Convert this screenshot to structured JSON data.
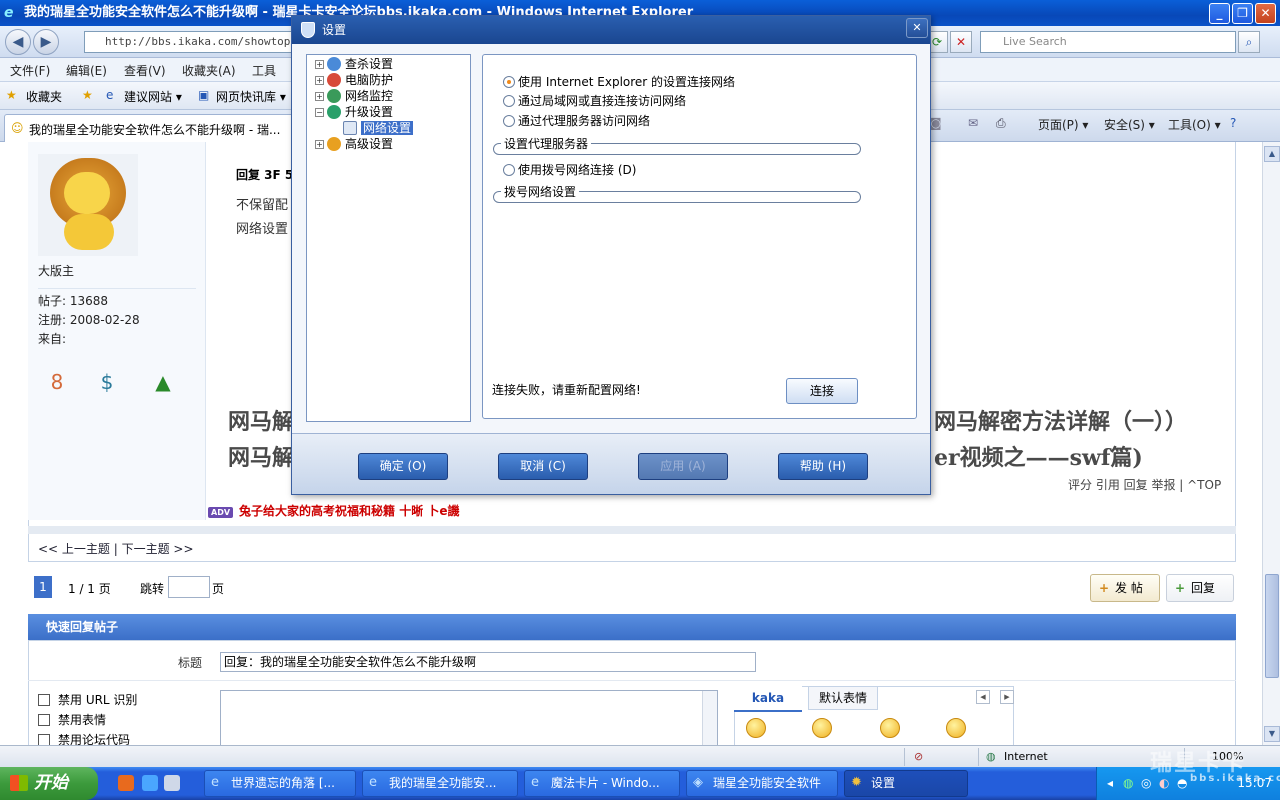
{
  "browser": {
    "title": "我的瑞星全功能安全软件怎么不能升级啊 - 瑞星卡卡安全论坛bbs.ikaka.com - Windows Internet Explorer",
    "url": "http://bbs.ikaka.com/showtopic",
    "search_placeholder": "Live Search",
    "menu": [
      "文件(F)",
      "编辑(E)",
      "查看(V)",
      "收藏夹(A)",
      "工具"
    ],
    "favorites": {
      "label": "收藏夹",
      "items": [
        "建议网站 ▾",
        "网页快讯库 ▾"
      ]
    },
    "tab_title": "我的瑞星全功能安全软件怎么不能升级啊 - 瑞...",
    "command_bar": [
      "页面(P) ▾",
      "安全(S) ▾",
      "工具(O) ▾"
    ]
  },
  "forum": {
    "user": {
      "name": "大版主",
      "posts": "帖子: 13688",
      "registered": "注册:  2008-02-28",
      "from": "来自:"
    },
    "post": {
      "header": "回复 3F 5",
      "line1": "不保留配",
      "line2": "网络设置"
    },
    "big_links": {
      "left1": "网马解",
      "left2": "网马解",
      "right1": "网马解密方法详解（一））",
      "right2": "er视频之——swf篇)"
    },
    "post_actions": "评分  引用  回复 举报 | ^TOP",
    "ad": {
      "badge": "ADV",
      "text": "兔子给大家的高考祝福和秘籍  十晰 卜e譏"
    },
    "prev_next": "<< 上一主题 | 下一主题 >>",
    "pager": {
      "current": "1",
      "total": "1  /  1  页",
      "jump": "跳转",
      "page": "页"
    },
    "new_post": "发 帖",
    "reply": "回复",
    "quick_reply": {
      "header": "快速回复帖子",
      "title_label": "标题",
      "title_value": "回复：我的瑞星全功能安全软件怎么不能升级啊",
      "options": [
        "禁用  URL 识别",
        "禁用表情",
        "禁用论坛代码"
      ],
      "smiley_tabs": [
        "kaka",
        "默认表情"
      ]
    }
  },
  "status_bar": {
    "zone": "Internet",
    "zoom": "100%"
  },
  "taskbar": {
    "start": "开始",
    "buttons": [
      "世界遗忘的角落 [...",
      "我的瑞星全功能安...",
      "魔法卡片 - Windo...",
      "瑞星全功能安全软件",
      "设置"
    ],
    "clock": "15:07"
  },
  "watermark": {
    "brand": "瑞星卡卡",
    "site": "bbs.ikaka.com"
  },
  "dialog": {
    "title": "设置",
    "tree": [
      "查杀设置",
      "电脑防护",
      "网络监控",
      "升级设置",
      "网络设置",
      "高级设置"
    ],
    "radios": [
      "使用 Internet Explorer 的设置连接网络",
      "通过局域网或直接连接访问网络",
      "通过代理服务器访问网络"
    ],
    "proxy_group": "设置代理服务器",
    "dial_option": "使用拨号网络连接 (D)",
    "dial_group": "拨号网络设置",
    "message": "连接失败，请重新配置网络!",
    "connect": "连接",
    "buttons": [
      "确定 (O)",
      "取消 (C)",
      "应用 (A)",
      "帮助 (H)"
    ]
  }
}
